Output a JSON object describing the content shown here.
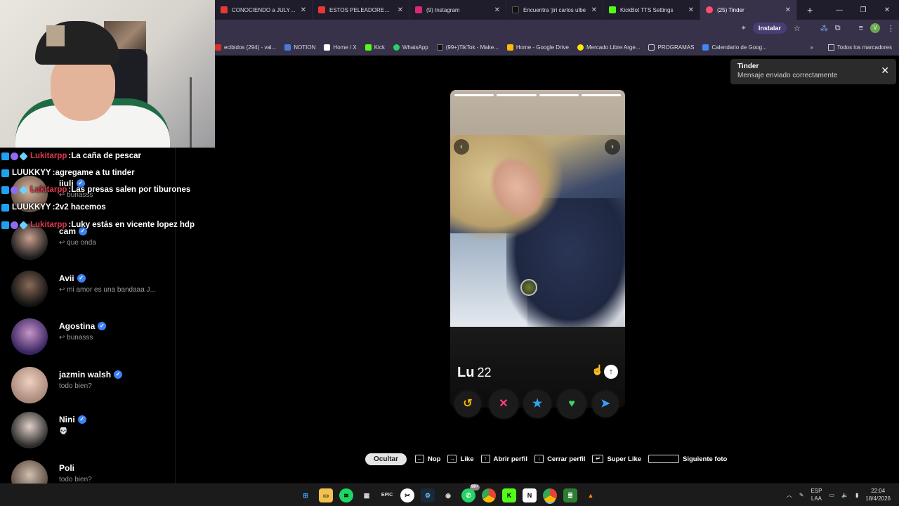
{
  "browser": {
    "tabs": [
      {
        "title": "CONOCIENDO a JULY PEI",
        "color": "#e53935"
      },
      {
        "title": "ESTOS PELEADORES DE U",
        "color": "#e53935"
      },
      {
        "title": "(9) Instagram",
        "color": "#d62976"
      },
      {
        "title": "Encuentra 'jiri carlos ulbe",
        "color": "#111111"
      },
      {
        "title": "KickBot TTS Settings",
        "color": "#53fc18"
      },
      {
        "title": "(25) Tinder",
        "color": "#fd5068",
        "active": true
      }
    ],
    "install_label": "Instalar",
    "profile_initial": "V",
    "bookmarks": [
      {
        "label": "ecibidos (294) - val...",
        "color": "#d93025"
      },
      {
        "label": "NOTION",
        "color": "#4a7bd8"
      },
      {
        "label": "Home / X",
        "color": "#ffffff"
      },
      {
        "label": "Kick",
        "color": "#53fc18"
      },
      {
        "label": "WhatsApp",
        "color": "#25d366"
      },
      {
        "label": "(99+)TikTok - Make...",
        "color": "#111111"
      },
      {
        "label": "Home - Google Drive",
        "color": "#fbbc04"
      },
      {
        "label": "Mercado Libre Arge...",
        "color": "#ffe600"
      },
      {
        "label": "PROGRAMAS",
        "color": "#cccccc"
      },
      {
        "label": "Calendario de Goog...",
        "color": "#4285f4"
      }
    ],
    "bookmarks_more": "»",
    "all_bookmarks": "Todos los marcadores"
  },
  "stream_chat": [
    {
      "user": "Lukitarpp",
      "user_color": "red",
      "message": "La caña de pescar"
    },
    {
      "user": "LUUKKYY",
      "user_color": "white",
      "message": "agregame a tu tinder"
    },
    {
      "user": "Lukitarpp",
      "user_color": "red",
      "message": "Las presas salen por tiburones"
    },
    {
      "user": "LUUKKYY",
      "user_color": "white",
      "message": "2v2 hacemos"
    },
    {
      "user": "Lukitarpp",
      "user_color": "red",
      "message": "Luky estás en vicente lopez hdp"
    }
  ],
  "matches": [
    {
      "name": "iiuli",
      "message": "↩ bunasss"
    },
    {
      "name": "cam",
      "message": "↩ que onda"
    },
    {
      "name": "Avii",
      "message": "↩ mi amor es una bandaaa J..."
    },
    {
      "name": "Agostina",
      "message": "↩ bunasss"
    },
    {
      "name": "jazmin walsh",
      "message": "todo bien?"
    },
    {
      "name": "Nini",
      "message": "💀"
    },
    {
      "name": "Poli",
      "message": "todo bien?"
    }
  ],
  "verified_glyph": "✓",
  "profile": {
    "name": "Lu",
    "age": "22",
    "photo_count": 4,
    "photo_index": 1
  },
  "toast": {
    "title": "Tinder",
    "message": "Mensaje enviado correctamente"
  },
  "hints": {
    "hide": "Ocultar",
    "items": [
      {
        "key": "←",
        "label": "Nop"
      },
      {
        "key": "→",
        "label": "Like"
      },
      {
        "key": "↑",
        "label": "Abrir perfil"
      },
      {
        "key": "↓",
        "label": "Cerrar perfil"
      },
      {
        "key": "↵",
        "label": "Super Like"
      },
      {
        "key": "",
        "label": "Siguiente foto"
      }
    ]
  },
  "taskbar": {
    "lang_top": "ESP",
    "lang_bottom": "LAA",
    "time": "22:04",
    "date": "18/4/2026",
    "whatsapp_badge": "99+"
  }
}
